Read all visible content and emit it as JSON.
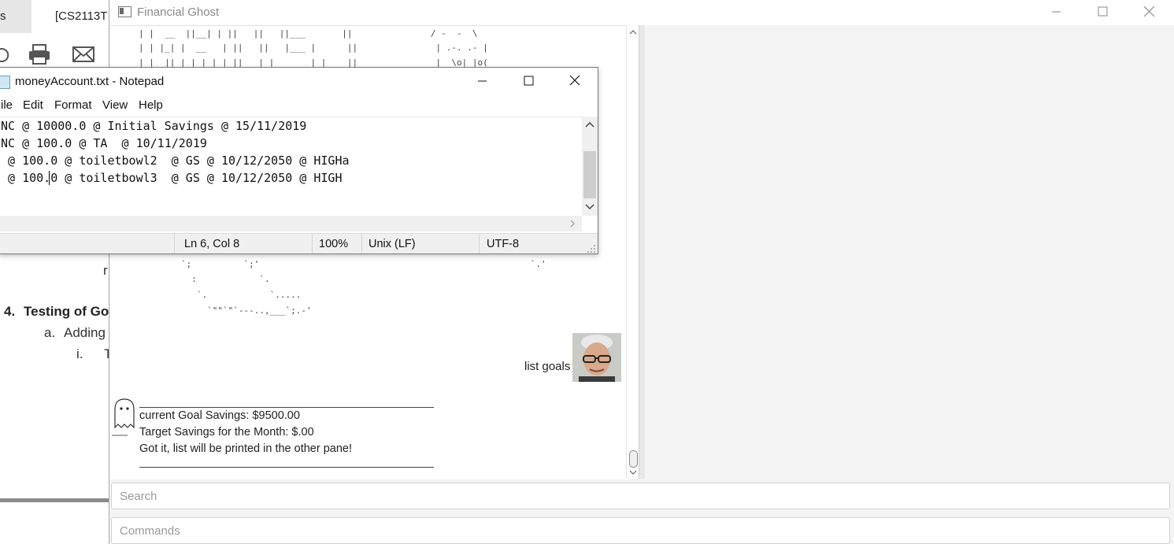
{
  "word_doc": {
    "tab_1": "s",
    "tab_2": "[CS2113T",
    "heading_number": "4.",
    "heading_text": "Testing of Go",
    "item_a_marker": "a.",
    "item_a_text": "Adding",
    "item_i_marker": "i.",
    "item_i_text": "T",
    "stray_char": "r"
  },
  "financial_ghost": {
    "window_title": "Financial Ghost",
    "user_message": "list goals",
    "bot_lines": [
      "current Goal Savings: $9500.00",
      "Target Savings for the Month: $.00",
      "Got it, list will be printed in the other pane!"
    ],
    "search_placeholder": "Search",
    "command_placeholder": "Commands",
    "ascii_top": [
      "| |  __  ||__| | ||   ||   ||___       ||               / -  -  \\",
      "| | |_| |  __   | ||   ||   |___ |      ||               | .-. .- |",
      "| |  || | | | | | ||   | |       | |    ||               |  \\o| |o("
    ],
    "ascii_bottom": [
      "`;          `;'                                                    `.'",
      "  :            `.",
      "   `.            `.....",
      "     `\"\"`\"`---..,___`;.-'"
    ]
  },
  "notepad": {
    "title": "moneyAccount.txt - Notepad",
    "menu": [
      "ile",
      "Edit",
      "Format",
      "View",
      "Help"
    ],
    "lines": [
      "NC @ 10000.0 @ Initial Savings @ 15/11/2019",
      "NC @ 100.0 @ TA  @ 10/11/2019",
      " @ 100.0 @ toiletbowl2  @ GS @ 10/12/2050 @ HIGHa",
      " @ 100.0 @ toiletbowl3  @ GS @ 10/12/2050 @ HIGH"
    ],
    "status": {
      "position": "Ln 6, Col 8",
      "zoom": "100%",
      "line_ending": "Unix (LF)",
      "encoding": "UTF-8"
    }
  }
}
